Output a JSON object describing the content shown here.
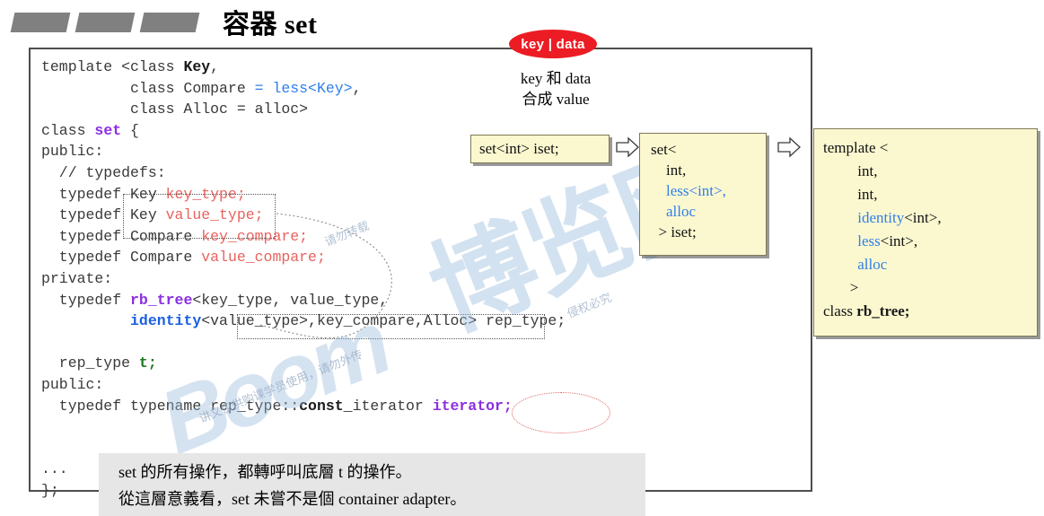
{
  "title": {
    "text": "容器 set",
    "bullet_icon": "parallelogram-bullet"
  },
  "code": {
    "lines": [
      [
        {
          "t": "template <class ",
          "c": "plain"
        },
        {
          "t": "Key",
          "c": "bold"
        },
        {
          "t": ",",
          "c": "plain"
        }
      ],
      [
        {
          "t": "          class Compare ",
          "c": "plain"
        },
        {
          "t": "= less<Key>",
          "c": "blue"
        },
        {
          "t": ",",
          "c": "plain"
        }
      ],
      [
        {
          "t": "          class Alloc = alloc>",
          "c": "plain"
        }
      ],
      [
        {
          "t": "class ",
          "c": "plain"
        },
        {
          "t": "set",
          "c": "purple"
        },
        {
          "t": " {",
          "c": "plain"
        }
      ],
      [
        {
          "t": "public:",
          "c": "plain"
        }
      ],
      [
        {
          "t": "  // typedefs:",
          "c": "plain"
        }
      ],
      [
        {
          "t": "  typedef Key ",
          "c": "plain"
        },
        {
          "t": "key_type;",
          "c": "red"
        }
      ],
      [
        {
          "t": "  typedef Key ",
          "c": "plain"
        },
        {
          "t": "value_type;",
          "c": "red"
        }
      ],
      [
        {
          "t": "  typedef Compare ",
          "c": "plain"
        },
        {
          "t": "key_compare;",
          "c": "red"
        }
      ],
      [
        {
          "t": "  typedef Compare ",
          "c": "plain"
        },
        {
          "t": "value_compare;",
          "c": "red"
        }
      ],
      [
        {
          "t": "private:",
          "c": "plain"
        }
      ],
      [
        {
          "t": "  typedef ",
          "c": "plain"
        },
        {
          "t": "rb_tree",
          "c": "purple"
        },
        {
          "t": "<key_type, value_type,",
          "c": "plain"
        }
      ],
      [
        {
          "t": "          ",
          "c": "plain"
        },
        {
          "t": "identity",
          "c": "blueb"
        },
        {
          "t": "<value_type>,key_compare,Alloc> rep_type;",
          "c": "plain"
        }
      ],
      [
        {
          "t": "",
          "c": "plain"
        }
      ],
      [
        {
          "t": "  rep_type ",
          "c": "plain"
        },
        {
          "t": "t;",
          "c": "green"
        }
      ],
      [
        {
          "t": "public:",
          "c": "plain"
        }
      ],
      [
        {
          "t": "  typedef typename rep_type::",
          "c": "plain"
        },
        {
          "t": "const_",
          "c": "bold"
        },
        {
          "t": "iterator ",
          "c": "plain"
        },
        {
          "t": "iterator;",
          "c": "purple"
        }
      ],
      [
        {
          "t": "",
          "c": "plain"
        }
      ],
      [
        {
          "t": "",
          "c": "plain"
        }
      ],
      [
        {
          "t": "...",
          "c": "plain"
        }
      ],
      [
        {
          "t": "};",
          "c": "plain"
        }
      ]
    ]
  },
  "callout": {
    "oval_label": "key | data",
    "note": "key 和 data\n合成 value"
  },
  "boxes": {
    "declaration": "set<int> iset;",
    "set_instantiation": [
      [
        {
          "t": "set<",
          "c": "plain"
        }
      ],
      [
        {
          "t": "    int,",
          "c": "plain"
        }
      ],
      [
        {
          "t": "    ",
          "c": "plain"
        },
        {
          "t": "less<int>,",
          "c": "blue"
        }
      ],
      [
        {
          "t": "    ",
          "c": "plain"
        },
        {
          "t": "alloc",
          "c": "blue"
        }
      ],
      [
        {
          "t": "  > iset;",
          "c": "plain"
        }
      ]
    ],
    "rbtree_instantiation": [
      [
        {
          "t": "template <",
          "c": "plain"
        }
      ],
      [
        {
          "t": "         int,",
          "c": "plain"
        }
      ],
      [
        {
          "t": "         int,",
          "c": "plain"
        }
      ],
      [
        {
          "t": "         ",
          "c": "plain"
        },
        {
          "t": "identity",
          "c": "blue"
        },
        {
          "t": "<int>,",
          "c": "plain"
        }
      ],
      [
        {
          "t": "         ",
          "c": "plain"
        },
        {
          "t": "less",
          "c": "blue"
        },
        {
          "t": "<int>,",
          "c": "plain"
        }
      ],
      [
        {
          "t": "         ",
          "c": "plain"
        },
        {
          "t": "alloc",
          "c": "blue"
        }
      ],
      [
        {
          "t": "       >",
          "c": "plain"
        }
      ],
      [
        {
          "t": "class ",
          "c": "plain"
        },
        {
          "t": "rb_tree;",
          "c": "bold"
        }
      ]
    ]
  },
  "arrows": {
    "arrow_1_icon": "hollow-right-arrow-icon",
    "arrow_2_icon": "hollow-right-arrow-icon"
  },
  "footnote": {
    "text": "set 的所有操作，都轉呼叫底層 t 的操作。\n從這層意義看，set 未嘗不是個 container adapter。"
  },
  "watermarks": {
    "boom": "Boom",
    "chinese": "博览网",
    "small_1": "讲义仅供购课学员使用，请勿外传",
    "small_2": "请勿转载",
    "small_3": "侵权必究"
  },
  "colors": {
    "accent_red": "#ec1c24",
    "box_yellow": "#fbf8d0",
    "code_red": "#e8635f",
    "code_blue": "#2f7fe8",
    "code_purple": "#8b2fe0",
    "code_green": "#1b7a1b",
    "footnote_gray": "#e6e6e6"
  }
}
